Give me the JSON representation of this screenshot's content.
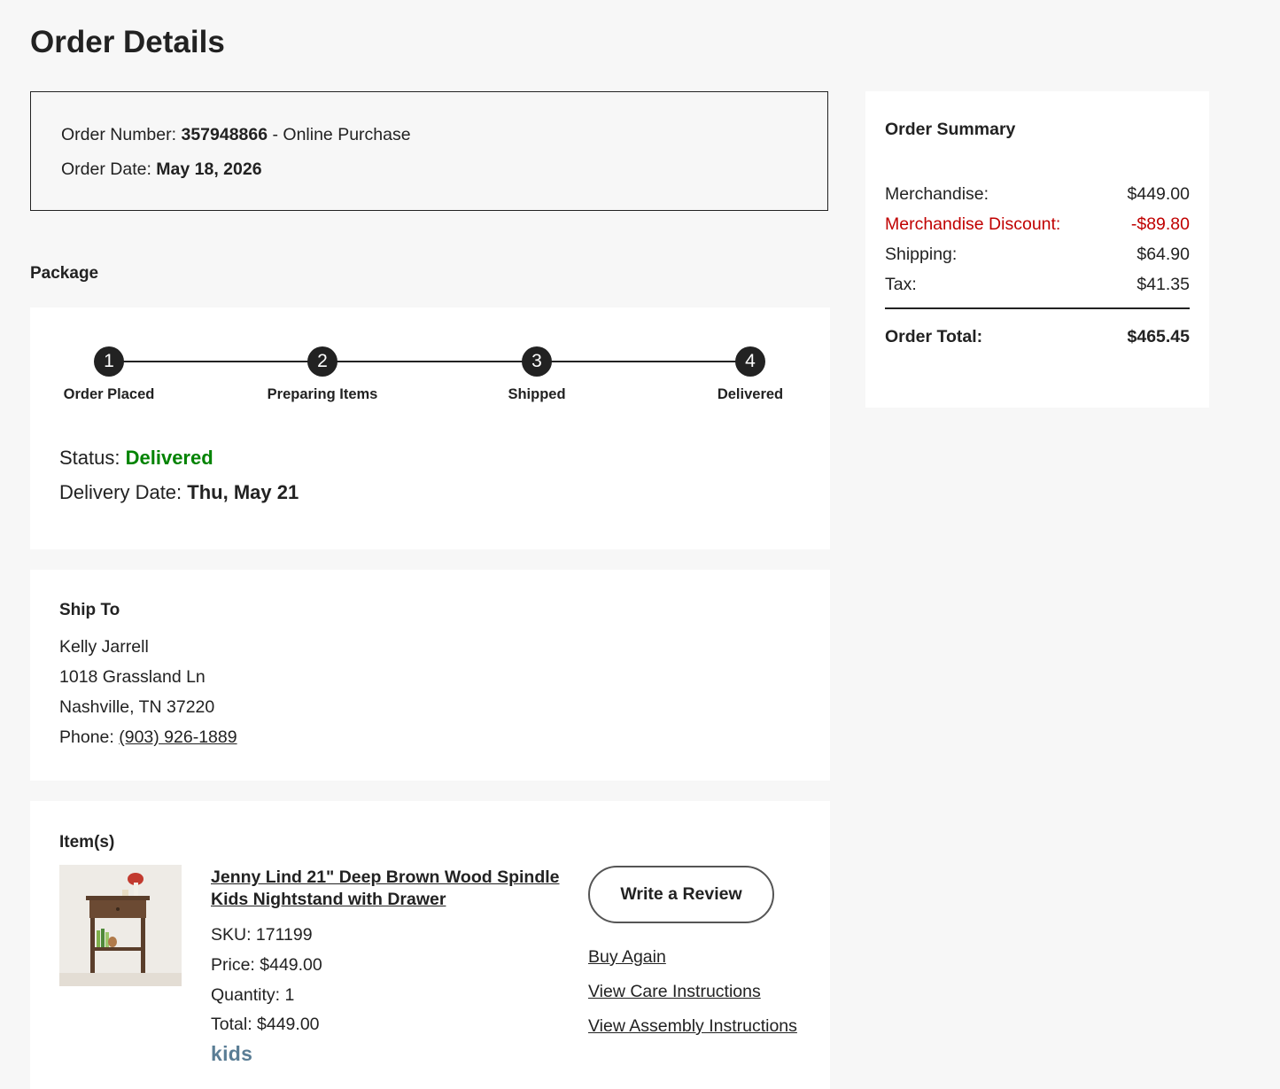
{
  "page": {
    "title": "Order Details"
  },
  "order": {
    "number_label": "Order Number:",
    "number": "357948866",
    "purchase_type": "- Online Purchase",
    "date_label": "Order Date:",
    "date": "May 18, 2026"
  },
  "package": {
    "section_label": "Package",
    "steps": [
      {
        "number": "1",
        "label": "Order Placed"
      },
      {
        "number": "2",
        "label": "Preparing Items"
      },
      {
        "number": "3",
        "label": "Shipped"
      },
      {
        "number": "4",
        "label": "Delivered"
      }
    ],
    "status_label": "Status:",
    "status": "Delivered",
    "delivery_label": "Delivery Date:",
    "delivery_date": "Thu, May 21"
  },
  "ship_to": {
    "title": "Ship To",
    "name": "Kelly Jarrell",
    "street": "1018 Grassland Ln",
    "city": "Nashville, TN 37220",
    "phone_label": "Phone:",
    "phone": "(903) 926-1889"
  },
  "items": {
    "title": "Item(s)",
    "product": {
      "name": "Jenny Lind 21\" Deep Brown Wood Spindle Kids Nightstand with Drawer",
      "sku": "SKU: 171199",
      "price": "Price: $449.00",
      "quantity": "Quantity: 1",
      "total": "Total: $449.00",
      "brand": "kids"
    },
    "actions": {
      "review": "Write a Review",
      "buy_again": "Buy Again",
      "care": "View Care Instructions",
      "assembly": "View Assembly Instructions"
    }
  },
  "summary": {
    "title": "Order Summary",
    "merchandise_label": "Merchandise:",
    "merchandise": "$449.00",
    "discount_label": "Merchandise Discount:",
    "discount": "-$89.80",
    "shipping_label": "Shipping:",
    "shipping": "$64.90",
    "tax_label": "Tax:",
    "tax": "$41.35",
    "total_label": "Order Total:",
    "total": "$465.45"
  },
  "colors": {
    "status_green": "#008300",
    "discount_red": "#c00000",
    "brand_blue": "#5a7d95"
  }
}
